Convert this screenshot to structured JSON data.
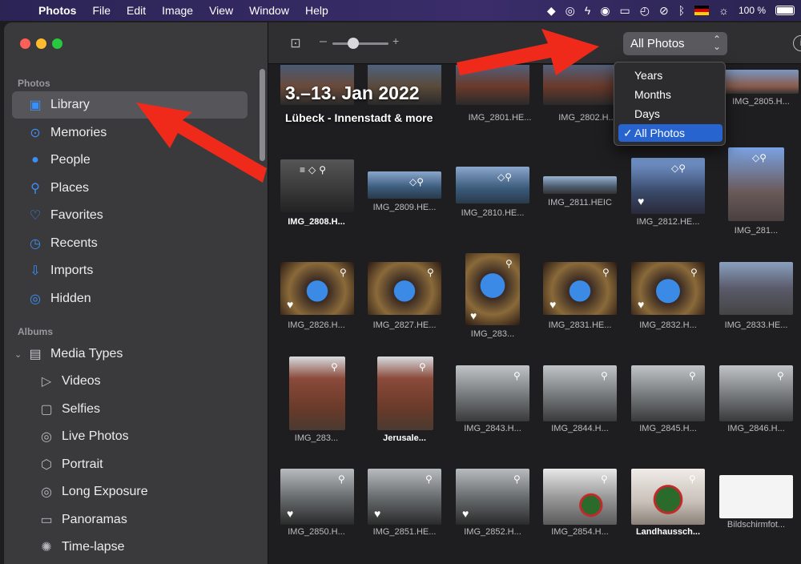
{
  "menubar": {
    "app_name": "Photos",
    "menus": [
      "File",
      "Edit",
      "Image",
      "View",
      "Window",
      "Help"
    ],
    "battery_percent": "100 %"
  },
  "sidebar": {
    "photos_header": "Photos",
    "albums_header": "Albums",
    "photos_items": [
      {
        "label": "Library",
        "icon": "library-icon"
      },
      {
        "label": "Memories",
        "icon": "memories-icon"
      },
      {
        "label": "People",
        "icon": "people-icon"
      },
      {
        "label": "Places",
        "icon": "places-icon"
      },
      {
        "label": "Favorites",
        "icon": "heart-icon"
      },
      {
        "label": "Recents",
        "icon": "clock-icon"
      },
      {
        "label": "Imports",
        "icon": "import-icon"
      },
      {
        "label": "Hidden",
        "icon": "eye-slash-icon"
      }
    ],
    "media_types": "Media Types",
    "album_items": [
      {
        "label": "Videos",
        "icon": "video-icon"
      },
      {
        "label": "Selfies",
        "icon": "selfie-icon"
      },
      {
        "label": "Live Photos",
        "icon": "live-photo-icon"
      },
      {
        "label": "Portrait",
        "icon": "cube-icon"
      },
      {
        "label": "Long Exposure",
        "icon": "long-exposure-icon"
      },
      {
        "label": "Panoramas",
        "icon": "panorama-icon"
      },
      {
        "label": "Time-lapse",
        "icon": "timelapse-icon"
      }
    ]
  },
  "toolbar": {
    "zoom_minus": "–",
    "zoom_plus": "+",
    "view_selected": "All Photos"
  },
  "view_menu": {
    "options": [
      "Years",
      "Months",
      "Days",
      "All Photos"
    ],
    "checked": "All Photos"
  },
  "grid": {
    "date_title": "3.–13. Jan 2022",
    "date_subtitle": "Lübeck - Innenstadt & more",
    "row0_captions": [
      "IMG_2801.HE...",
      "IMG_2802.H...",
      "IMG_2805.H..."
    ],
    "captions": [
      [
        "IMG_2808.H...",
        "IMG_2809.HE...",
        "IMG_2810.HE...",
        "IMG_2811.HEIC",
        "IMG_2812.HE...",
        "IMG_281..."
      ],
      [
        "IMG_2826.H...",
        "IMG_2827.HE...",
        "IMG_283...",
        "IMG_2831.HE...",
        "IMG_2832.H...",
        "IMG_2833.HE..."
      ],
      [
        "IMG_283...",
        "Jerusale...",
        "IMG_2843.H...",
        "IMG_2844.H...",
        "IMG_2845.H...",
        "IMG_2846.H..."
      ],
      [
        "IMG_2850.H...",
        "IMG_2851.HE...",
        "IMG_2852.H...",
        "IMG_2854.H...",
        "Landhaussch...",
        "Bildschirmfot..."
      ]
    ]
  }
}
